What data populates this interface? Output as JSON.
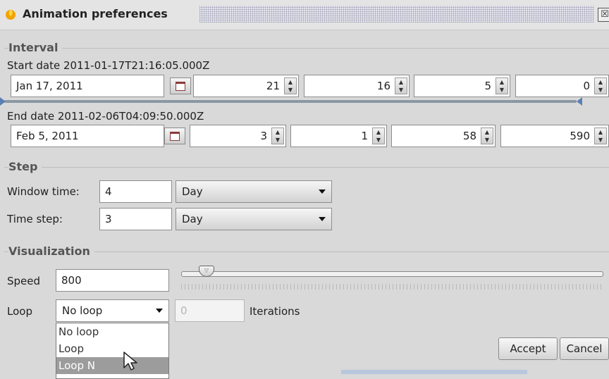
{
  "window": {
    "title": "Animation preferences",
    "close_glyph": "☒"
  },
  "interval": {
    "section_title": "Interval",
    "start": {
      "label": "Start date 2011-01-17T21:16:05.000Z",
      "date": "Jan 17, 2011",
      "hour": "21",
      "minute": "16",
      "second": "5",
      "millisecond": "0"
    },
    "end": {
      "label": "End date 2011-02-06T04:09:50.000Z",
      "date": "Feb 5, 2011",
      "hour": "3",
      "minute": "1",
      "second": "58",
      "millisecond": "590"
    }
  },
  "step": {
    "section_title": "Step",
    "window_time": {
      "label": "Window time:",
      "value": "4",
      "unit": "Day"
    },
    "time_step": {
      "label": "Time step:",
      "value": "3",
      "unit": "Day"
    }
  },
  "visualization": {
    "section_title": "Visualization",
    "speed": {
      "label": "Speed",
      "value": "800"
    },
    "loop": {
      "label": "Loop",
      "selected": "No loop",
      "iterations_value": "0",
      "iterations_label": "Iterations",
      "options": [
        "No loop",
        "Loop",
        "Loop N"
      ]
    }
  },
  "buttons": {
    "accept": "Accept",
    "cancel": "Cancel"
  },
  "icons": {
    "app": "app-flame-icon",
    "calendar": "calendar-icon",
    "spinner": "spinner-arrows-icon",
    "dropdown": "chevron-down-icon",
    "cursor": "mouse-pointer-icon"
  }
}
